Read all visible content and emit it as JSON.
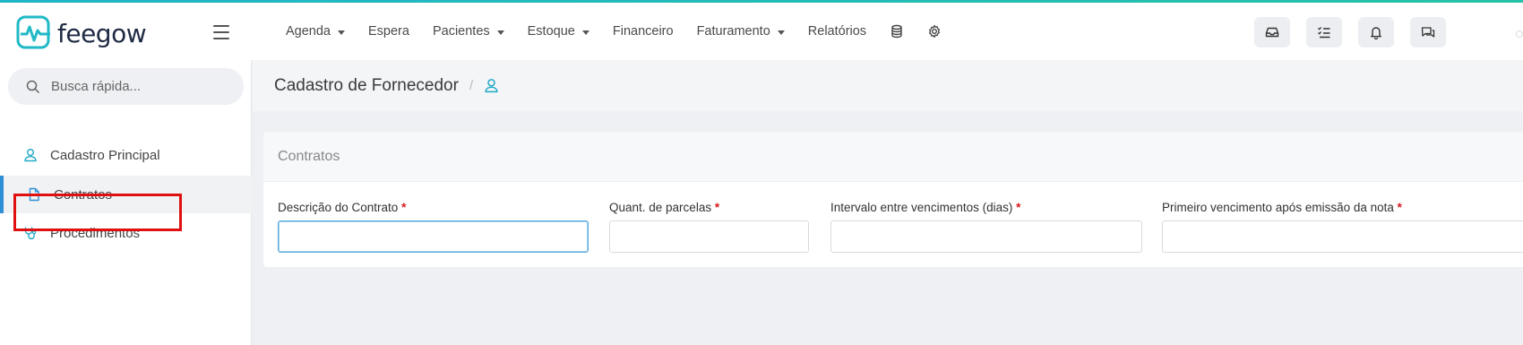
{
  "brand": {
    "name": "feegow",
    "accent": "#20b9c6"
  },
  "nav": {
    "items": [
      {
        "label": "Agenda",
        "dropdown": true
      },
      {
        "label": "Espera",
        "dropdown": false
      },
      {
        "label": "Pacientes",
        "dropdown": true
      },
      {
        "label": "Estoque",
        "dropdown": true
      },
      {
        "label": "Financeiro",
        "dropdown": false
      },
      {
        "label": "Faturamento",
        "dropdown": true
      },
      {
        "label": "Relatórios",
        "dropdown": false
      }
    ],
    "icons": [
      "database-icon",
      "gear-icon"
    ]
  },
  "header_actions": [
    "inbox-icon",
    "checklist-icon",
    "bell-icon",
    "chat-icon"
  ],
  "search": {
    "placeholder": "Busca rápida..."
  },
  "sidebar": {
    "items": [
      {
        "label": "Cadastro Principal",
        "icon": "user-icon",
        "active": false
      },
      {
        "label": "Contratos",
        "icon": "document-icon",
        "active": true
      },
      {
        "label": "Procedimentos",
        "icon": "stethoscope-icon",
        "active": false
      }
    ]
  },
  "page": {
    "title": "Cadastro de Fornecedor",
    "breadcrumb_separator": "/"
  },
  "panel": {
    "title": "Contratos",
    "fields": [
      {
        "label": "Descrição do Contrato",
        "required": "*",
        "value": ""
      },
      {
        "label": "Quant. de parcelas",
        "required": "*",
        "value": ""
      },
      {
        "label": "Intervalo entre vencimentos (dias)",
        "required": "*",
        "value": ""
      },
      {
        "label": "Primeiro vencimento após emissão da nota",
        "required": "*",
        "value": ""
      }
    ]
  },
  "colors": {
    "active_bar": "#2e8fd6",
    "required": "#d9181e",
    "highlight": "#e01010"
  }
}
